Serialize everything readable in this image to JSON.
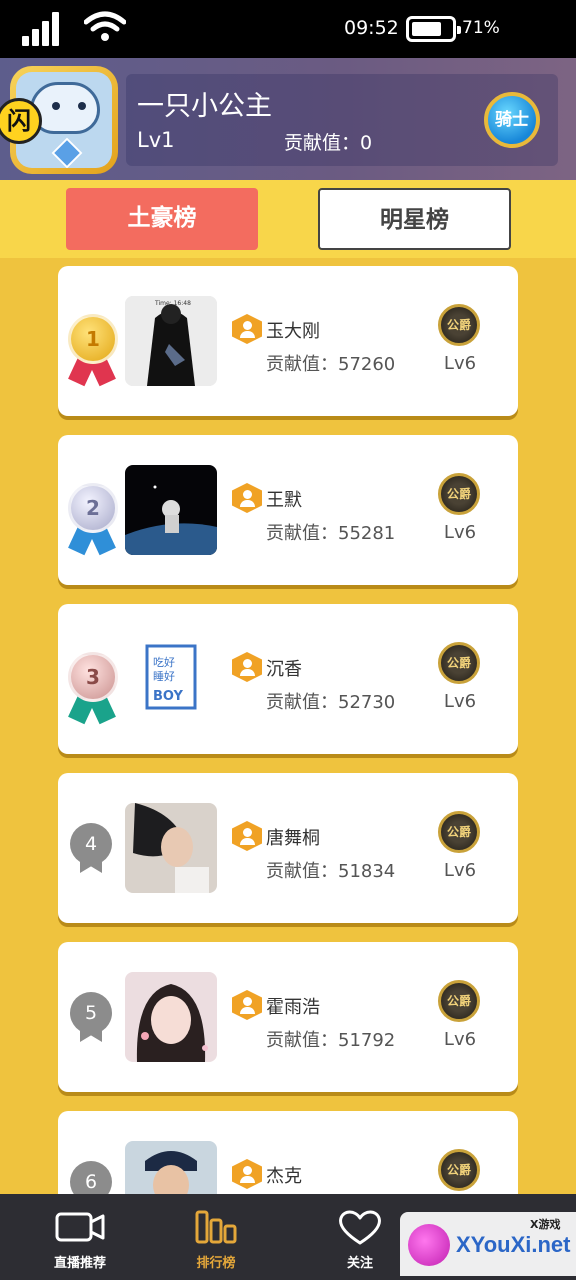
{
  "status_bar": {
    "time": "09:52",
    "battery": "71%"
  },
  "profile": {
    "name": "一只小公主",
    "level": "Lv1",
    "contribution": "贡献值：0",
    "avatar_badge": "闪",
    "rank_badge": "骑士"
  },
  "tabs": [
    {
      "label": "土豪榜",
      "active": true
    },
    {
      "label": "明星榜",
      "active": false
    }
  ],
  "rankings": [
    {
      "rank": "1",
      "name": "玉大刚",
      "contribution": "贡献值：57260",
      "badge": "公爵",
      "level": "Lv6"
    },
    {
      "rank": "2",
      "name": "王默",
      "contribution": "贡献值：55281",
      "badge": "公爵",
      "level": "Lv6"
    },
    {
      "rank": "3",
      "name": "沉香",
      "contribution": "贡献值：52730",
      "badge": "公爵",
      "level": "Lv6"
    },
    {
      "rank": "4",
      "name": "唐舞桐",
      "contribution": "贡献值：51834",
      "badge": "公爵",
      "level": "Lv6"
    },
    {
      "rank": "5",
      "name": "霍雨浩",
      "contribution": "贡献值：51792",
      "badge": "公爵",
      "level": "Lv6"
    },
    {
      "rank": "6",
      "name": "杰克",
      "contribution": "",
      "badge": "公爵",
      "level": ""
    }
  ],
  "photo_texts": {
    "rank1_caption": "Time: 16:48",
    "rank3_logo_top": "吃好\n睡好",
    "rank3_logo_bottom": "BOY"
  },
  "bottom_nav": [
    {
      "label": "直播推荐",
      "icon": "video-camera-icon",
      "active": false
    },
    {
      "label": "排行榜",
      "icon": "bar-chart-icon",
      "active": true
    },
    {
      "label": "关注",
      "icon": "heart-icon",
      "active": false
    }
  ],
  "watermark": {
    "site": "XYouXi.net",
    "sub": "X游戏"
  },
  "colors": {
    "accent_tab": "#F36C5F",
    "background": "#EFC33E",
    "nav_active": "#E4A73A"
  }
}
